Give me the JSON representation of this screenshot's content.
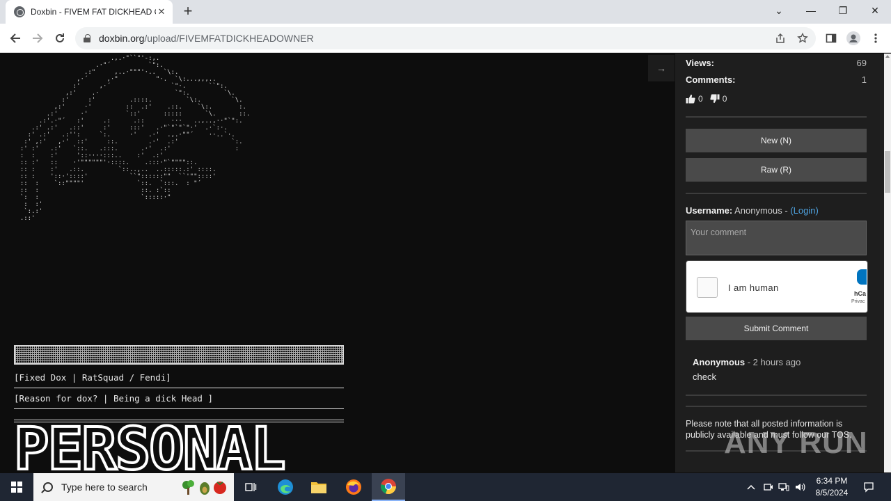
{
  "browser": {
    "tab_title": "Doxbin - FIVEM FAT DICKHEAD O",
    "tab_close": "✕",
    "new_tab": "+",
    "url_host": "doxbin.org",
    "url_path": "/upload/FIVEMFATDICKHEADOWNER",
    "controls": {
      "tab_search": "⌄",
      "minimize": "—",
      "restore": "❐",
      "close": "✕"
    }
  },
  "paste": {
    "art_lines": [
      "                          .,.·\"``\"'-:,.",
      "                      .·\"´          `\":.",
      "                   .:\"     ,..·\"\"\"'·..  `\\:.",
      "                 ,·´     ,·\"          \"·.  `\\:...,,,..",
      "                :'     ,·´                `\"·.      ``\":.",
      "              ,:'    .·                    `\":.         `\\.",
      "             :'     :'         .::::.         `\\:.        `\\.",
      "           ,:'     ·'         ::  .:'    .::.    `\\:.       :.",
      "         .:'      ·'          `::'      :::::      `\\.      ::.",
      "       .:'.·\"´   :'     .:      .::       ···   ..,..,··\"`\":.",
      "     .:' .:'   .::'     :'     :::'   .·\"`\"`\"`\"·'  .·`:·.",
      "    :' .:'   .:'':     `:.     ·'   .·'  .,.·\"\"´    ··..`·.",
      "   :' ,:'   ,·'  ::'     ::.        .·'  .:'              `:.",
      "  :' :'   .:'   `::.   .:::.      .·'  .:'                 :",
      "  :  :    :'     '::····:::..    :'  .:'",
      "  :: :'   ::    ·'\"\"\"\"\"\"'·::::.    .:::·\"`\"\"\"\"::.",
      "  :: :    :'   .::.         `::..,..  ..:::::.:' ::::.",
      "  :: :    '::·'::::'           ``\"::::::\"\"  ``'\"\"::::'",
      "  ::  :    `::\"\"\"\"'              `::.  `:::.  : \"´",
      "  ::  :                           ::. :`::",
      "  `:  :                           `:::::·\"",
      "   :  :'",
      "   `:.:'",
      "  .::'"
    ],
    "fixed_dox": "[Fixed Dox | RatSquad / Fendi]",
    "reason": "[Reason for dox? | Being a dick Head ]",
    "section_title": "PERSONAL"
  },
  "sidebar": {
    "collapse_icon": "→",
    "views_label": "Views:",
    "views": "69",
    "comments_label": "Comments:",
    "comments": "1",
    "likes": "0",
    "dislikes": "0",
    "new_button": "New (N)",
    "raw_button": "Raw (R)",
    "username_label": "Username:",
    "username_value": "Anonymous - ",
    "login_link": "(Login)",
    "comment_placeholder": "Your comment",
    "captcha_label": "I am human",
    "captcha_brand": "hCa",
    "captcha_privacy": "Privac",
    "submit_button": "Submit Comment",
    "comment_author": "Anonymous",
    "comment_time": " - 2 hours ago",
    "comment_text": "check",
    "note": "Please note that all posted information is publicly available and must follow our TOS."
  },
  "watermark": "ANY  RUN",
  "taskbar": {
    "search_placeholder": "Type here to search",
    "time": "6:34 PM",
    "date": "8/5/2024"
  },
  "colors": {
    "page_bg": "#0d0d0d",
    "sidebar_bg": "#1e1e1e",
    "button_bg": "#4a4a4a",
    "link": "#4fa3e0",
    "taskbar_bg": "#1f2633"
  }
}
